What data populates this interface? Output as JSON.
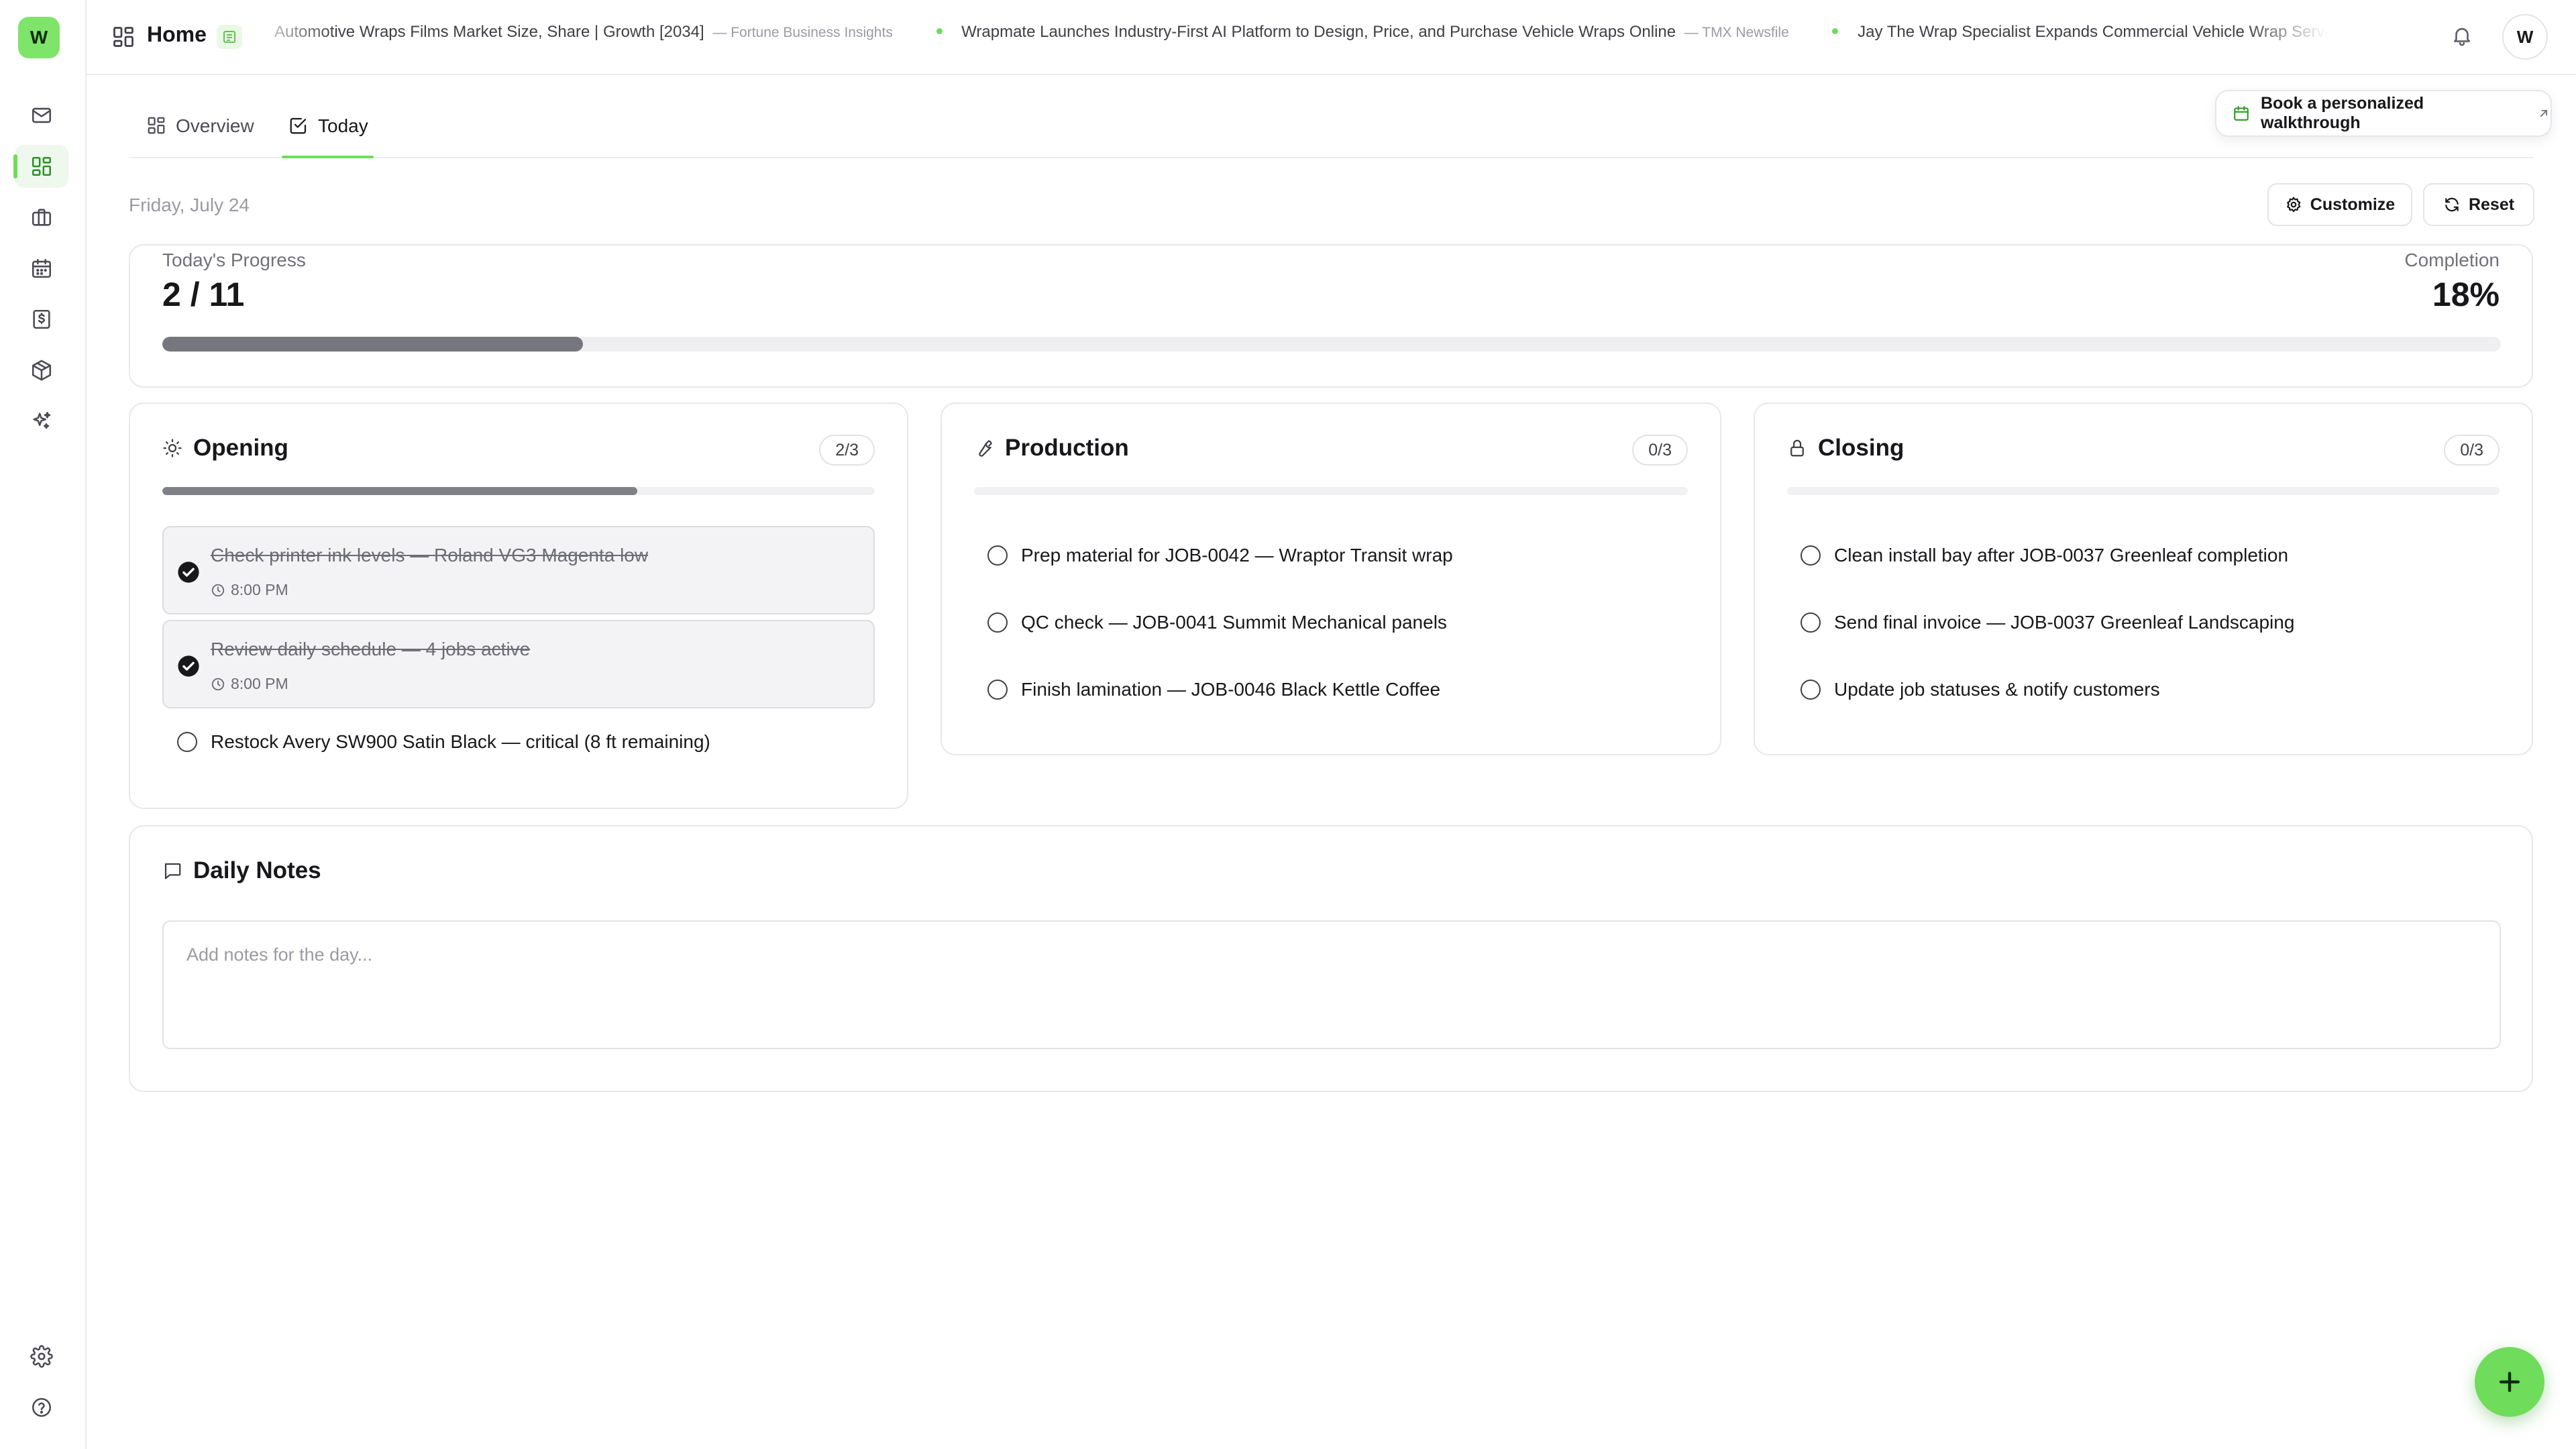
{
  "app": {
    "logo_letter": "W",
    "brand_color": "#6fdc5b"
  },
  "sidebar": {
    "items": [
      {
        "name": "mail-icon"
      },
      {
        "name": "dashboard-icon",
        "active": true
      },
      {
        "name": "briefcase-icon"
      },
      {
        "name": "calendar-icon"
      },
      {
        "name": "invoice-icon"
      },
      {
        "name": "package-icon"
      },
      {
        "name": "sparkles-icon"
      }
    ],
    "bottom": [
      {
        "name": "settings-icon"
      },
      {
        "name": "help-icon"
      }
    ]
  },
  "header": {
    "title": "Home",
    "news": [
      {
        "headline": "Automotive Wraps Films Market Size, Share | Growth [2034]",
        "source": "— Fortune Business Insights"
      },
      {
        "headline": "Wrapmate Launches Industry-First AI Platform to Design, Price, and Purchase Vehicle Wraps Online",
        "source": "— TMX Newsfile"
      },
      {
        "headline": "Jay The Wrap Specialist Expands Commercial Vehicle Wrap Services for Mobile",
        "source": ""
      }
    ],
    "avatar_initial": "W"
  },
  "tabs": [
    {
      "label": "Overview",
      "active": false
    },
    {
      "label": "Today",
      "active": true
    }
  ],
  "walkthrough_button": "Book a personalized walkthrough",
  "date": "Friday, July 24",
  "actions": {
    "customize": "Customize",
    "reset": "Reset"
  },
  "progress": {
    "label": "Today's Progress",
    "value": "2 / 11",
    "completion_label": "Completion",
    "completion_value": "18%",
    "fraction": 0.18
  },
  "sections": {
    "opening": {
      "title": "Opening",
      "count": "2/3",
      "fraction": 0.667,
      "tasks": [
        {
          "text": "Check printer ink levels — Roland VG3 Magenta low",
          "time": "8:00 PM",
          "done": true
        },
        {
          "text": "Review daily schedule — 4 jobs active",
          "time": "8:00 PM",
          "done": true
        },
        {
          "text": "Restock Avery SW900 Satin Black — critical (8 ft remaining)",
          "done": false
        }
      ]
    },
    "production": {
      "title": "Production",
      "count": "0/3",
      "fraction": 0,
      "tasks": [
        {
          "text": "Prep material for JOB-0042 — Wraptor Transit wrap",
          "done": false
        },
        {
          "text": "QC check — JOB-0041 Summit Mechanical panels",
          "done": false
        },
        {
          "text": "Finish lamination — JOB-0046 Black Kettle Coffee",
          "done": false
        }
      ]
    },
    "closing": {
      "title": "Closing",
      "count": "0/3",
      "fraction": 0,
      "tasks": [
        {
          "text": "Clean install bay after JOB-0037 Greenleaf completion",
          "done": false
        },
        {
          "text": "Send final invoice — JOB-0037 Greenleaf Landscaping",
          "done": false
        },
        {
          "text": "Update job statuses & notify customers",
          "done": false
        }
      ]
    }
  },
  "notes": {
    "title": "Daily Notes",
    "placeholder": "Add notes for the day..."
  }
}
